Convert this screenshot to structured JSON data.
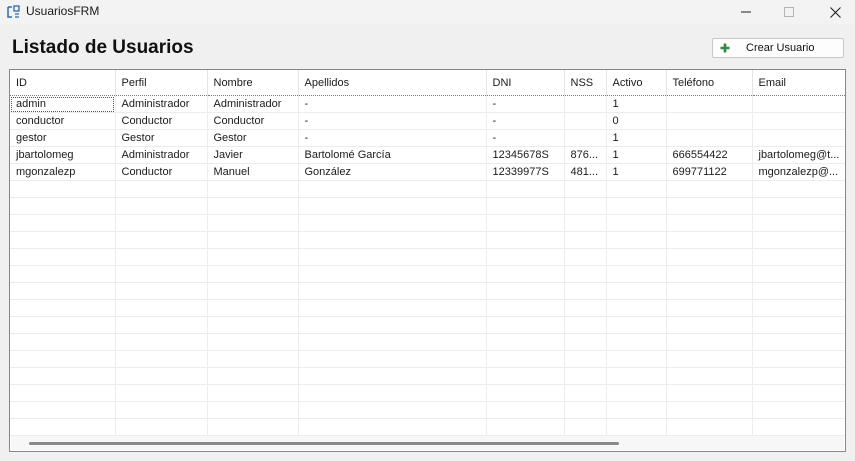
{
  "window": {
    "title": "UsuariosFRM"
  },
  "header": {
    "title": "Listado de Usuarios",
    "create_button_label": "Crear Usuario"
  },
  "table": {
    "columns": [
      "ID",
      "Perfil",
      "Nombre",
      "Apellidos",
      "DNI",
      "NSS",
      "Activo",
      "Teléfono",
      "Email"
    ],
    "rows": [
      [
        "admin",
        "Administrador",
        "Administrador",
        "-",
        "-",
        "",
        "1",
        "",
        ""
      ],
      [
        "conductor",
        "Conductor",
        "Conductor",
        "-",
        "-",
        "",
        "0",
        "",
        ""
      ],
      [
        "gestor",
        "Gestor",
        "Gestor",
        "-",
        "-",
        "",
        "1",
        "",
        ""
      ],
      [
        "jbartolomeg",
        "Administrador",
        "Javier",
        "Bartolomé García",
        "12345678S",
        "876...",
        "1",
        "666554422",
        "jbartolomeg@t..."
      ],
      [
        "mgonzalezp",
        "Conductor",
        "Manuel",
        "González",
        "12339977S",
        "481...",
        "1",
        "699771122",
        "mgonzalezp@..."
      ]
    ]
  },
  "colors": {
    "plus_icon": "#2e8b3a",
    "grid_border": "#828790",
    "grid_lines": "#ececec"
  },
  "icons": {
    "app": "form-icon",
    "minimize": "minimize-icon",
    "maximize": "maximize-icon",
    "close": "close-icon",
    "add": "plus-icon"
  }
}
